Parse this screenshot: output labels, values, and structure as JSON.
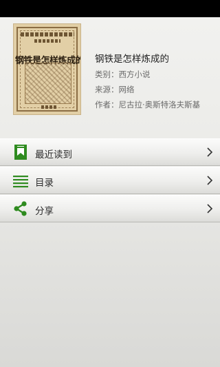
{
  "book": {
    "cover_title": "钢铁是怎样炼成的",
    "title": "钢铁是怎样炼成的",
    "category_label": "类别：",
    "category_value": "西方小说",
    "source_label": "来源：",
    "source_value": "网络",
    "author_label": "作者：",
    "author_value": "尼古拉·奥斯特洛夫斯基"
  },
  "menu": {
    "items": [
      {
        "label": "最近读到",
        "icon": "bookmark-icon"
      },
      {
        "label": "目录",
        "icon": "list-icon"
      },
      {
        "label": "分享",
        "icon": "share-icon"
      }
    ]
  },
  "colors": {
    "accent": "#2e8b1f",
    "statusbar": "#000000"
  }
}
